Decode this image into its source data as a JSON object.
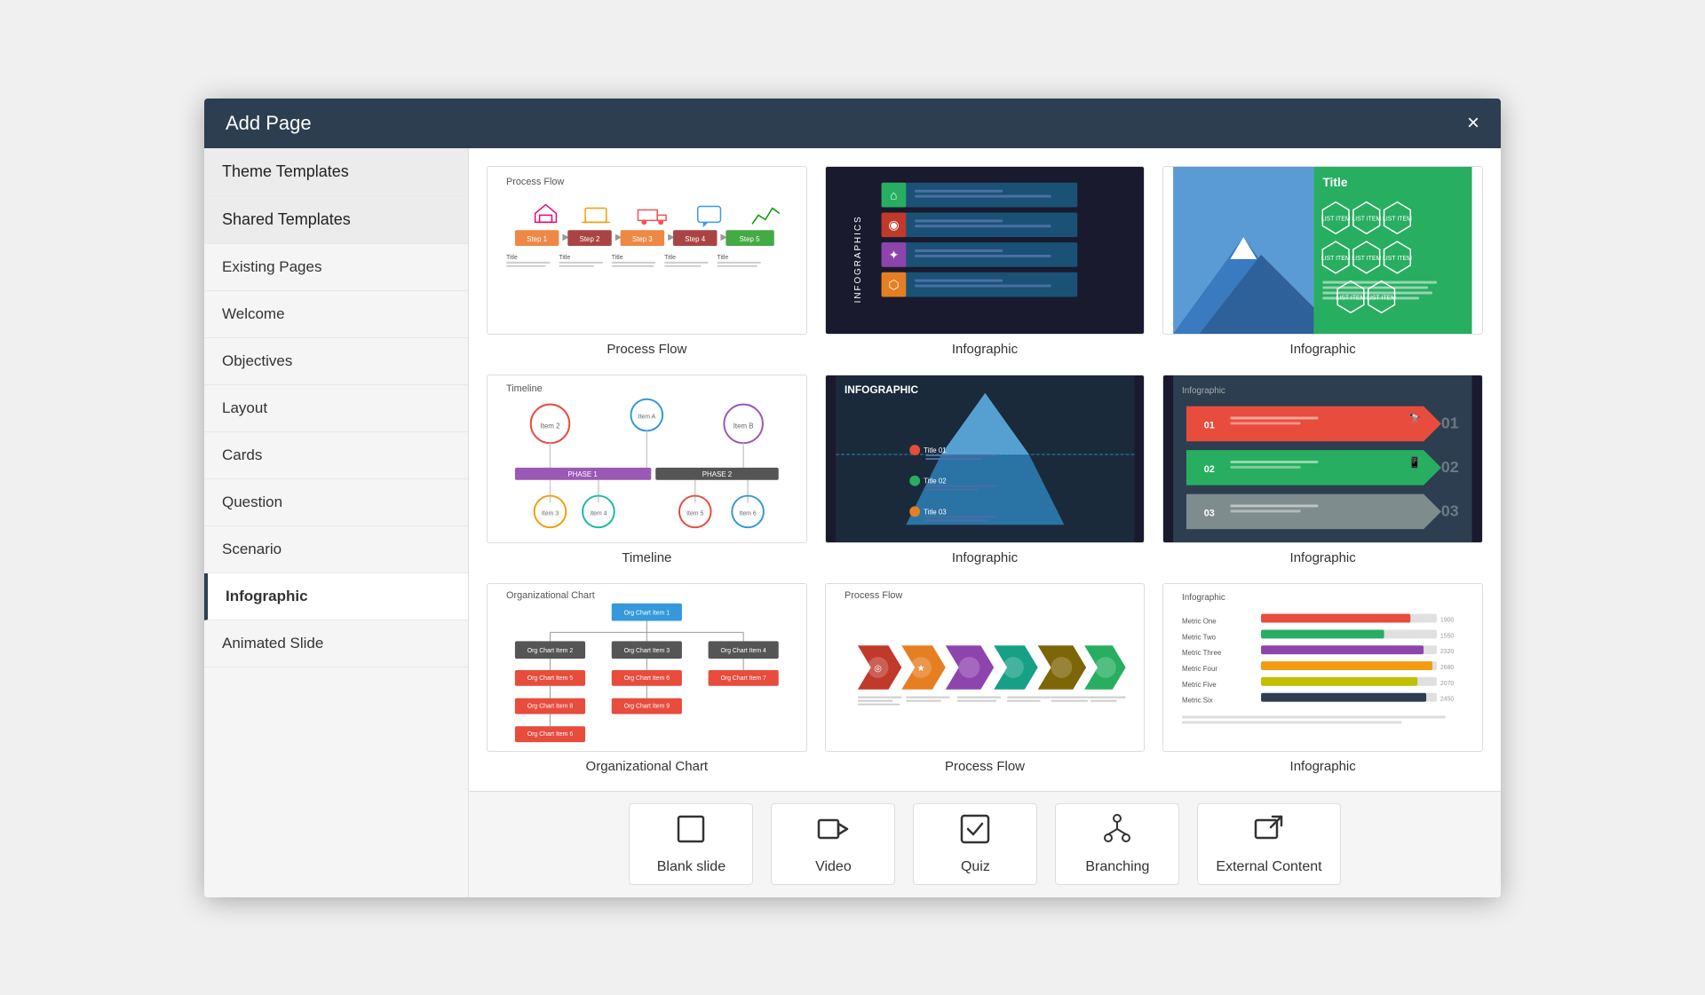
{
  "modal": {
    "title": "Add Page",
    "close_label": "×"
  },
  "sidebar": {
    "items": [
      {
        "id": "theme-templates",
        "label": "Theme Templates",
        "type": "section"
      },
      {
        "id": "shared-templates",
        "label": "Shared Templates",
        "type": "section"
      },
      {
        "id": "existing-pages",
        "label": "Existing Pages",
        "type": "item"
      },
      {
        "id": "welcome",
        "label": "Welcome",
        "type": "item"
      },
      {
        "id": "objectives",
        "label": "Objectives",
        "type": "item"
      },
      {
        "id": "layout",
        "label": "Layout",
        "type": "item"
      },
      {
        "id": "cards",
        "label": "Cards",
        "type": "item"
      },
      {
        "id": "question",
        "label": "Question",
        "type": "item"
      },
      {
        "id": "scenario",
        "label": "Scenario",
        "type": "item"
      },
      {
        "id": "infographic",
        "label": "Infographic",
        "type": "item",
        "active": true
      },
      {
        "id": "animated-slide",
        "label": "Animated Slide",
        "type": "item"
      }
    ]
  },
  "templates": [
    {
      "id": "process-flow-1",
      "label": "Process Flow",
      "type": "light"
    },
    {
      "id": "infographic-dark-1",
      "label": "Infographic",
      "type": "dark"
    },
    {
      "id": "infographic-green-1",
      "label": "Infographic",
      "type": "green"
    },
    {
      "id": "timeline-1",
      "label": "Timeline",
      "type": "light"
    },
    {
      "id": "infographic-dark-2",
      "label": "Infographic",
      "type": "iceberg"
    },
    {
      "id": "infographic-dark-3",
      "label": "Infographic",
      "type": "arrows_dark"
    },
    {
      "id": "org-chart-1",
      "label": "Organizational Chart",
      "type": "org"
    },
    {
      "id": "process-flow-2",
      "label": "Process Flow",
      "type": "arrows_color"
    },
    {
      "id": "infographic-bars-1",
      "label": "Infographic",
      "type": "bars"
    }
  ],
  "bottom_buttons": [
    {
      "id": "blank-slide",
      "label": "Blank slide",
      "icon": "blank"
    },
    {
      "id": "video",
      "label": "Video",
      "icon": "video"
    },
    {
      "id": "quiz",
      "label": "Quiz",
      "icon": "quiz"
    },
    {
      "id": "branching",
      "label": "Branching",
      "icon": "branching"
    },
    {
      "id": "external-content",
      "label": "External Content",
      "icon": "external"
    }
  ]
}
